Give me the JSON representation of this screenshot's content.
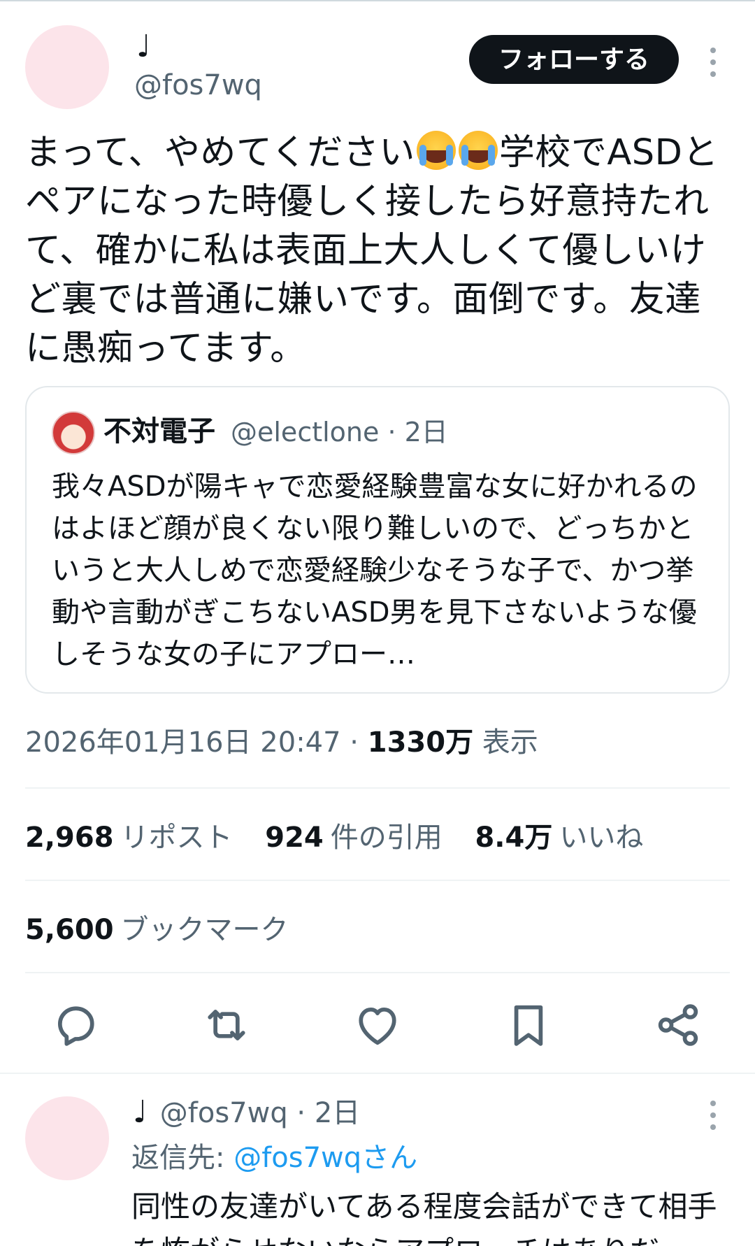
{
  "main_tweet": {
    "display_name": "♩",
    "handle": "@fos7wq",
    "follow_label": "フォローする",
    "text_part1": "まって、やめてください",
    "emoji_name": "loudly-crying-face",
    "text_part2": "学校でASDとペアになった時優しく接したら好意持たれて、確かに私は表面上大人しくて優しいけど裏では普通に嫌いです。面倒です。友達に愚痴ってます。",
    "quote": {
      "display_name": "不対電子",
      "meta": "@electlone · 2日",
      "text": "我々ASDが陽キャで恋愛経験豊富な女に好かれるのはよほど顔が良くない限り難しいので、どっちかというと大人しめで恋愛経験少なそうな子で、かつ挙動や言動がぎこちないASD男を見下さないような優しそうな女の子にアプロー…"
    },
    "timestamp": "2026年01月16日 20:47 · ",
    "views_count": "1330万",
    "views_label": " 表示",
    "stats": {
      "reposts_num": "2,968",
      "reposts_label": "リポスト",
      "quotes_num": "924",
      "quotes_label": "件の引用",
      "likes_num": "8.4万",
      "likes_label": "いいね",
      "bookmarks_num": "5,600",
      "bookmarks_label": "ブックマーク"
    },
    "actions": [
      "reply-icon",
      "repost-icon",
      "like-icon",
      "bookmark-icon",
      "share-icon"
    ]
  },
  "reply": {
    "display_name": "♩",
    "meta": "@fos7wq · 2日",
    "reply_to_label": "返信先: ",
    "reply_to_handle": "@fos7wqさん",
    "text": "同性の友達がいてある程度会話ができて相手を怖がらせないならアプローチはありだ"
  },
  "colors": {
    "text": "#0f1419",
    "secondary": "#536471",
    "link": "#1d9bf0",
    "avatar_placeholder": "#fce4ea",
    "button_bg": "#0f1419"
  }
}
